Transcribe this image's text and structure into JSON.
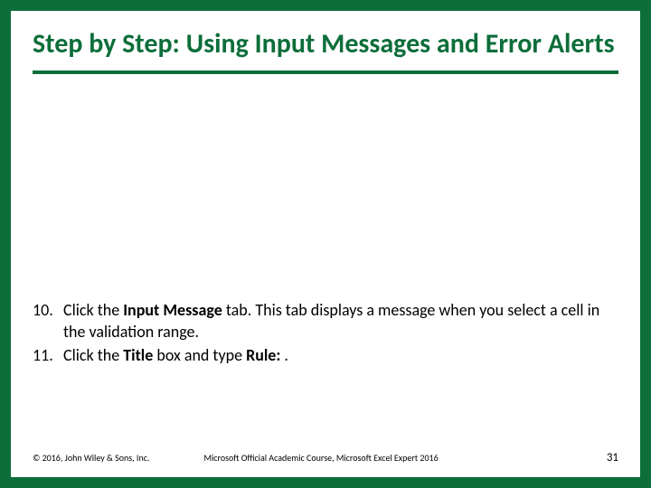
{
  "title": "Step by Step: Using Input Messages and Error Alerts",
  "items": [
    {
      "num": "10.",
      "pre": "Click the ",
      "bold1": "Input Message",
      "post": " tab. This tab displays a message when you select a cell in the validation range."
    },
    {
      "num": "11.",
      "pre": "Click the ",
      "bold1": "Title",
      "mid": " box and type ",
      "bold2": "Rule:",
      "post": " ."
    }
  ],
  "footer": {
    "copyright": "© 2016, John Wiley & Sons, Inc.",
    "course": "Microsoft Official Academic Course, Microsoft Excel Expert 2016",
    "page": "31"
  }
}
